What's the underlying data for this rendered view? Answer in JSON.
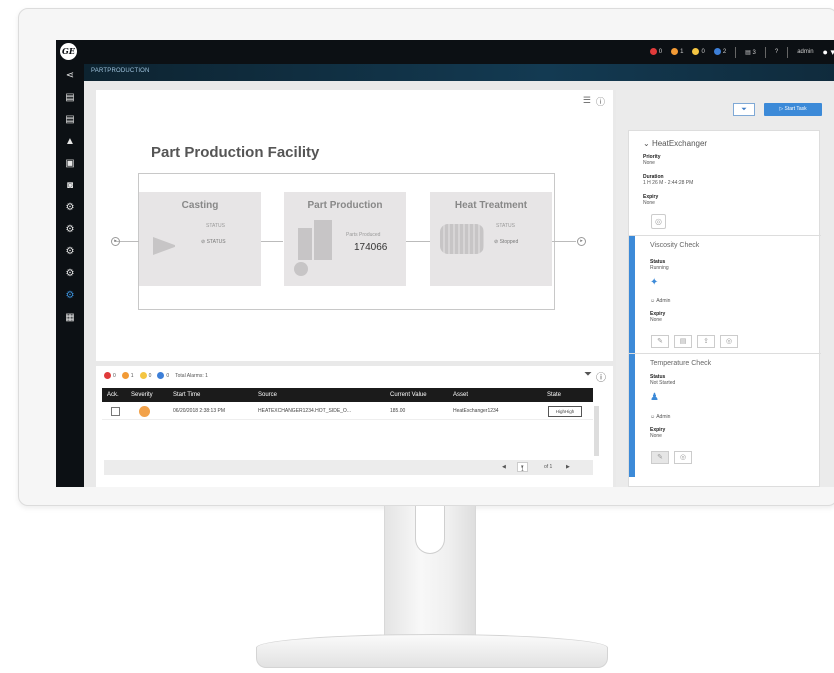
{
  "topbar": {
    "logo": "GE",
    "alerts": [
      {
        "count": "0",
        "color": "#e03a3a"
      },
      {
        "count": "1",
        "color": "#f29a35"
      },
      {
        "count": "0",
        "color": "#f4c542"
      },
      {
        "count": "2",
        "color": "#3d7fd8"
      }
    ],
    "messages": "3",
    "help_icon": "help-icon",
    "user": "admin"
  },
  "breadcrumb": "PARTPRODUCTION",
  "sidenav": [
    "share-icon",
    "asset-icon",
    "asset-list-icon",
    "alert-icon",
    "image-icon",
    "camera-icon",
    "gear-user-icon",
    "gear-user-icon",
    "gear-user-icon",
    "gear-user-icon",
    "gear-active-icon",
    "clipboard-icon"
  ],
  "facility": {
    "title": "Part Production Facility",
    "casting": {
      "title": "Casting",
      "status_label": "STATUS",
      "status": "STATUS"
    },
    "part_production": {
      "title": "Part Production",
      "produced_label": "Parts Produced",
      "produced_value": "174066"
    },
    "heat_treatment": {
      "title": "Heat Treatment",
      "status_label": "STATUS",
      "status": "Stopped"
    }
  },
  "alarms": {
    "counts": [
      {
        "count": "0",
        "color": "#e03a3a"
      },
      {
        "count": "1",
        "color": "#f29a35"
      },
      {
        "count": "0",
        "color": "#f4c542"
      },
      {
        "count": "0",
        "color": "#3d7fd8"
      }
    ],
    "total": "Total Alarms: 1",
    "headers": [
      "Ack.",
      "Severity",
      "Start Time",
      "Source",
      "Current Value",
      "Asset",
      "State"
    ],
    "rows": [
      {
        "start": "06/20/2018 2:38:13 PM",
        "source": "HEATEXCHANGER1234.HOT_SIDE_O...",
        "value": "185.00",
        "asset": "HeatExchanger1234",
        "state": "HighHigh"
      }
    ],
    "page": "1",
    "of": "of 1"
  },
  "tasks": {
    "start_label": "Start Task",
    "asset": "HeatExchanger",
    "priority_label": "Priority",
    "priority": "None",
    "duration_label": "Duration",
    "duration": "1 H 26 M - 2:44:28 PM",
    "expiry_label": "Expiry",
    "expiry": "None",
    "steps": [
      {
        "title": "Viscosity Check",
        "status_label": "Status",
        "status": "Running",
        "user": "Admin",
        "expiry_label": "Expiry",
        "expiry": "None"
      },
      {
        "title": "Temperature Check",
        "status_label": "Status",
        "status": "Not Started",
        "user": "Admin",
        "expiry_label": "Expiry",
        "expiry": "None"
      }
    ]
  }
}
